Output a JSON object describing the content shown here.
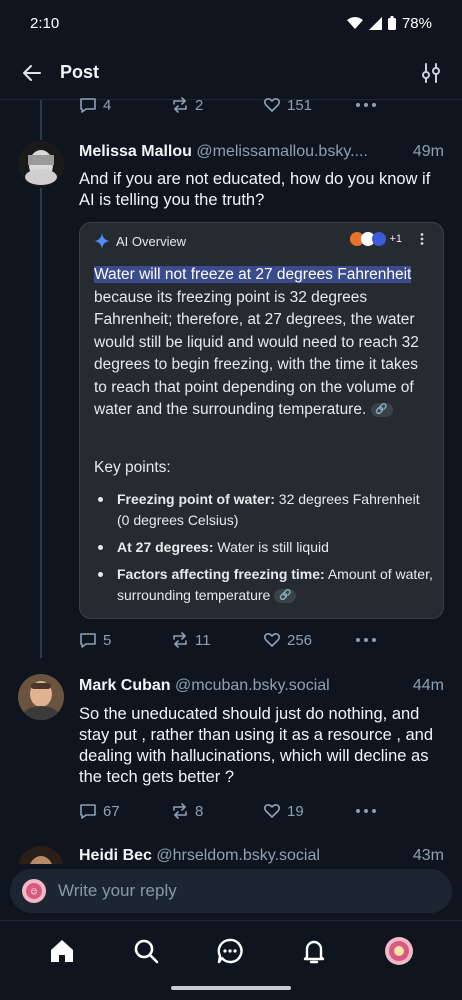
{
  "status": {
    "time": "2:10",
    "battery": "78%"
  },
  "header": {
    "title": "Post",
    "back_icon": "arrow-left-icon",
    "filter_icon": "sliders-icon"
  },
  "parent_actions": {
    "replies": "4",
    "reposts": "2",
    "likes": "151"
  },
  "posts": [
    {
      "name": "Melissa Mallou",
      "handle": "@melissamallou.bsky....",
      "time": "49m",
      "text": "And if you are not educated, how do you know if AI is telling you the truth?",
      "ai_overview": {
        "label": "AI Overview",
        "source_count": "+1",
        "highlight": "Water will not freeze at 27 degrees Fahrenheit",
        "body": " because its freezing point is 32 degrees Fahrenheit; therefore, at 27 degrees, the water would still be liquid and would need to reach 32 degrees to begin freezing, with the time it takes to reach that point depending on the volume of water and the surrounding temperature. ",
        "key_points_title": "Key points:",
        "key_points": [
          {
            "bold": "Freezing point of water:",
            "text": " 32 degrees Fahrenheit (0 degrees Celsius)"
          },
          {
            "bold": "At 27 degrees:",
            "text": " Water is still liquid"
          },
          {
            "bold": "Factors affecting freezing time:",
            "text": " Amount of water, surrounding temperature "
          }
        ]
      },
      "replies": "5",
      "reposts": "11",
      "likes": "256"
    },
    {
      "name": "Mark Cuban",
      "handle": "@mcuban.bsky.social",
      "time": "44m",
      "text": "So the uneducated should just do nothing, and stay put , rather than using it as a resource , and dealing with hallucinations, which will decline as the tech gets better ?",
      "replies": "67",
      "reposts": "8",
      "likes": "19"
    },
    {
      "name": "Heidi Bec",
      "handle": "@hrseldom.bsky.social",
      "time": "43m"
    }
  ],
  "composer": {
    "placeholder": "Write your reply"
  },
  "nav": [
    "home-icon",
    "search-icon",
    "chat-icon",
    "bell-icon",
    "profile-avatar"
  ],
  "colors": {
    "background": "#0f151e",
    "accent": "#1083fe",
    "muted": "#8da0b6",
    "highlight": "#3b4c8c"
  }
}
